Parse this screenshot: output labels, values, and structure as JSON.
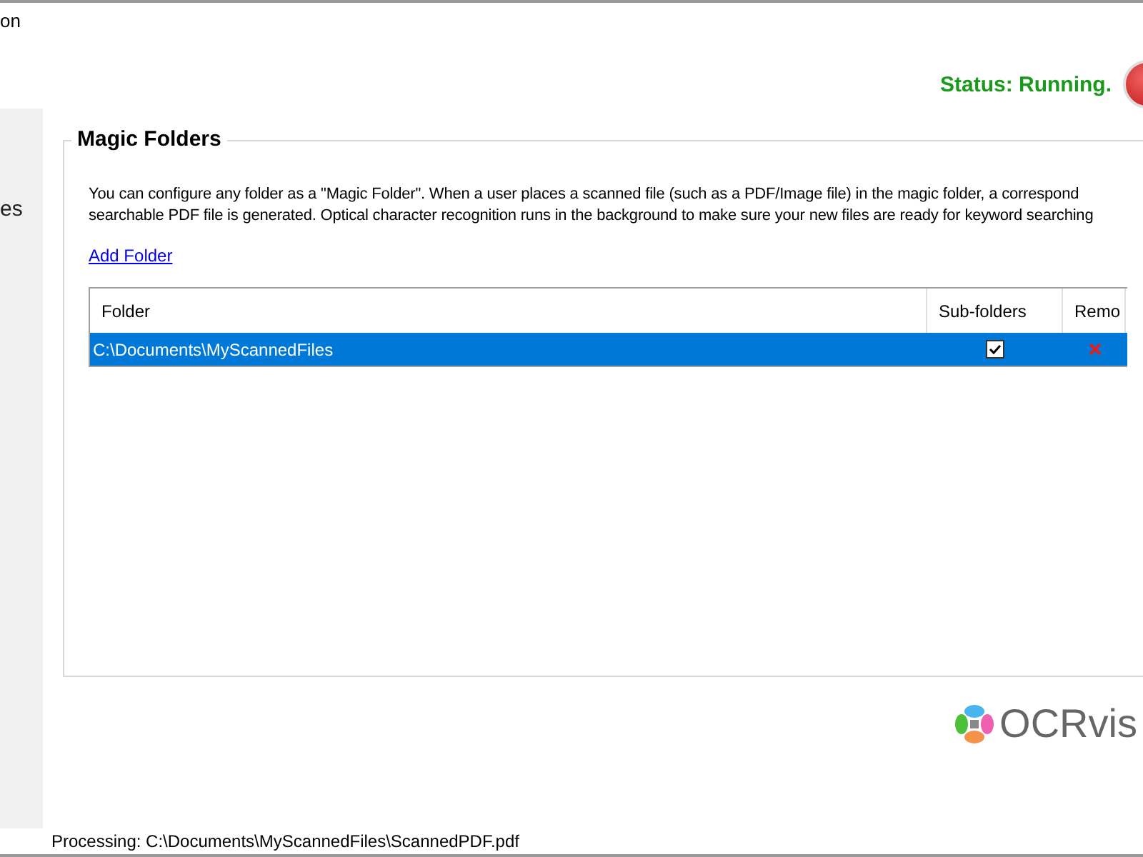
{
  "window": {
    "title": "on"
  },
  "sidebar": {
    "items": [
      {
        "label": "es",
        "selected": false
      }
    ]
  },
  "status": {
    "text": "Status: Running."
  },
  "magic_folders": {
    "title": "Magic Folders",
    "description_lines": [
      "You can configure any folder as a \"Magic Folder\". When a user places a scanned file (such as a PDF/Image file) in the magic folder, a correspond",
      "searchable PDF file is generated. Optical character recognition runs in the background to make sure your new files are ready for keyword searching"
    ],
    "add_link": "Add Folder",
    "table": {
      "columns": [
        "Folder",
        "Sub-folders",
        "Remo"
      ],
      "rows": [
        {
          "folder": "C:\\Documents\\MyScannedFiles",
          "subfolders": true,
          "selected": true
        }
      ]
    }
  },
  "logo": {
    "text": "OCRvis"
  },
  "status_bar": {
    "text": "Processing: C:\\Documents\\MyScannedFiles\\ScannedPDF.pdf"
  }
}
